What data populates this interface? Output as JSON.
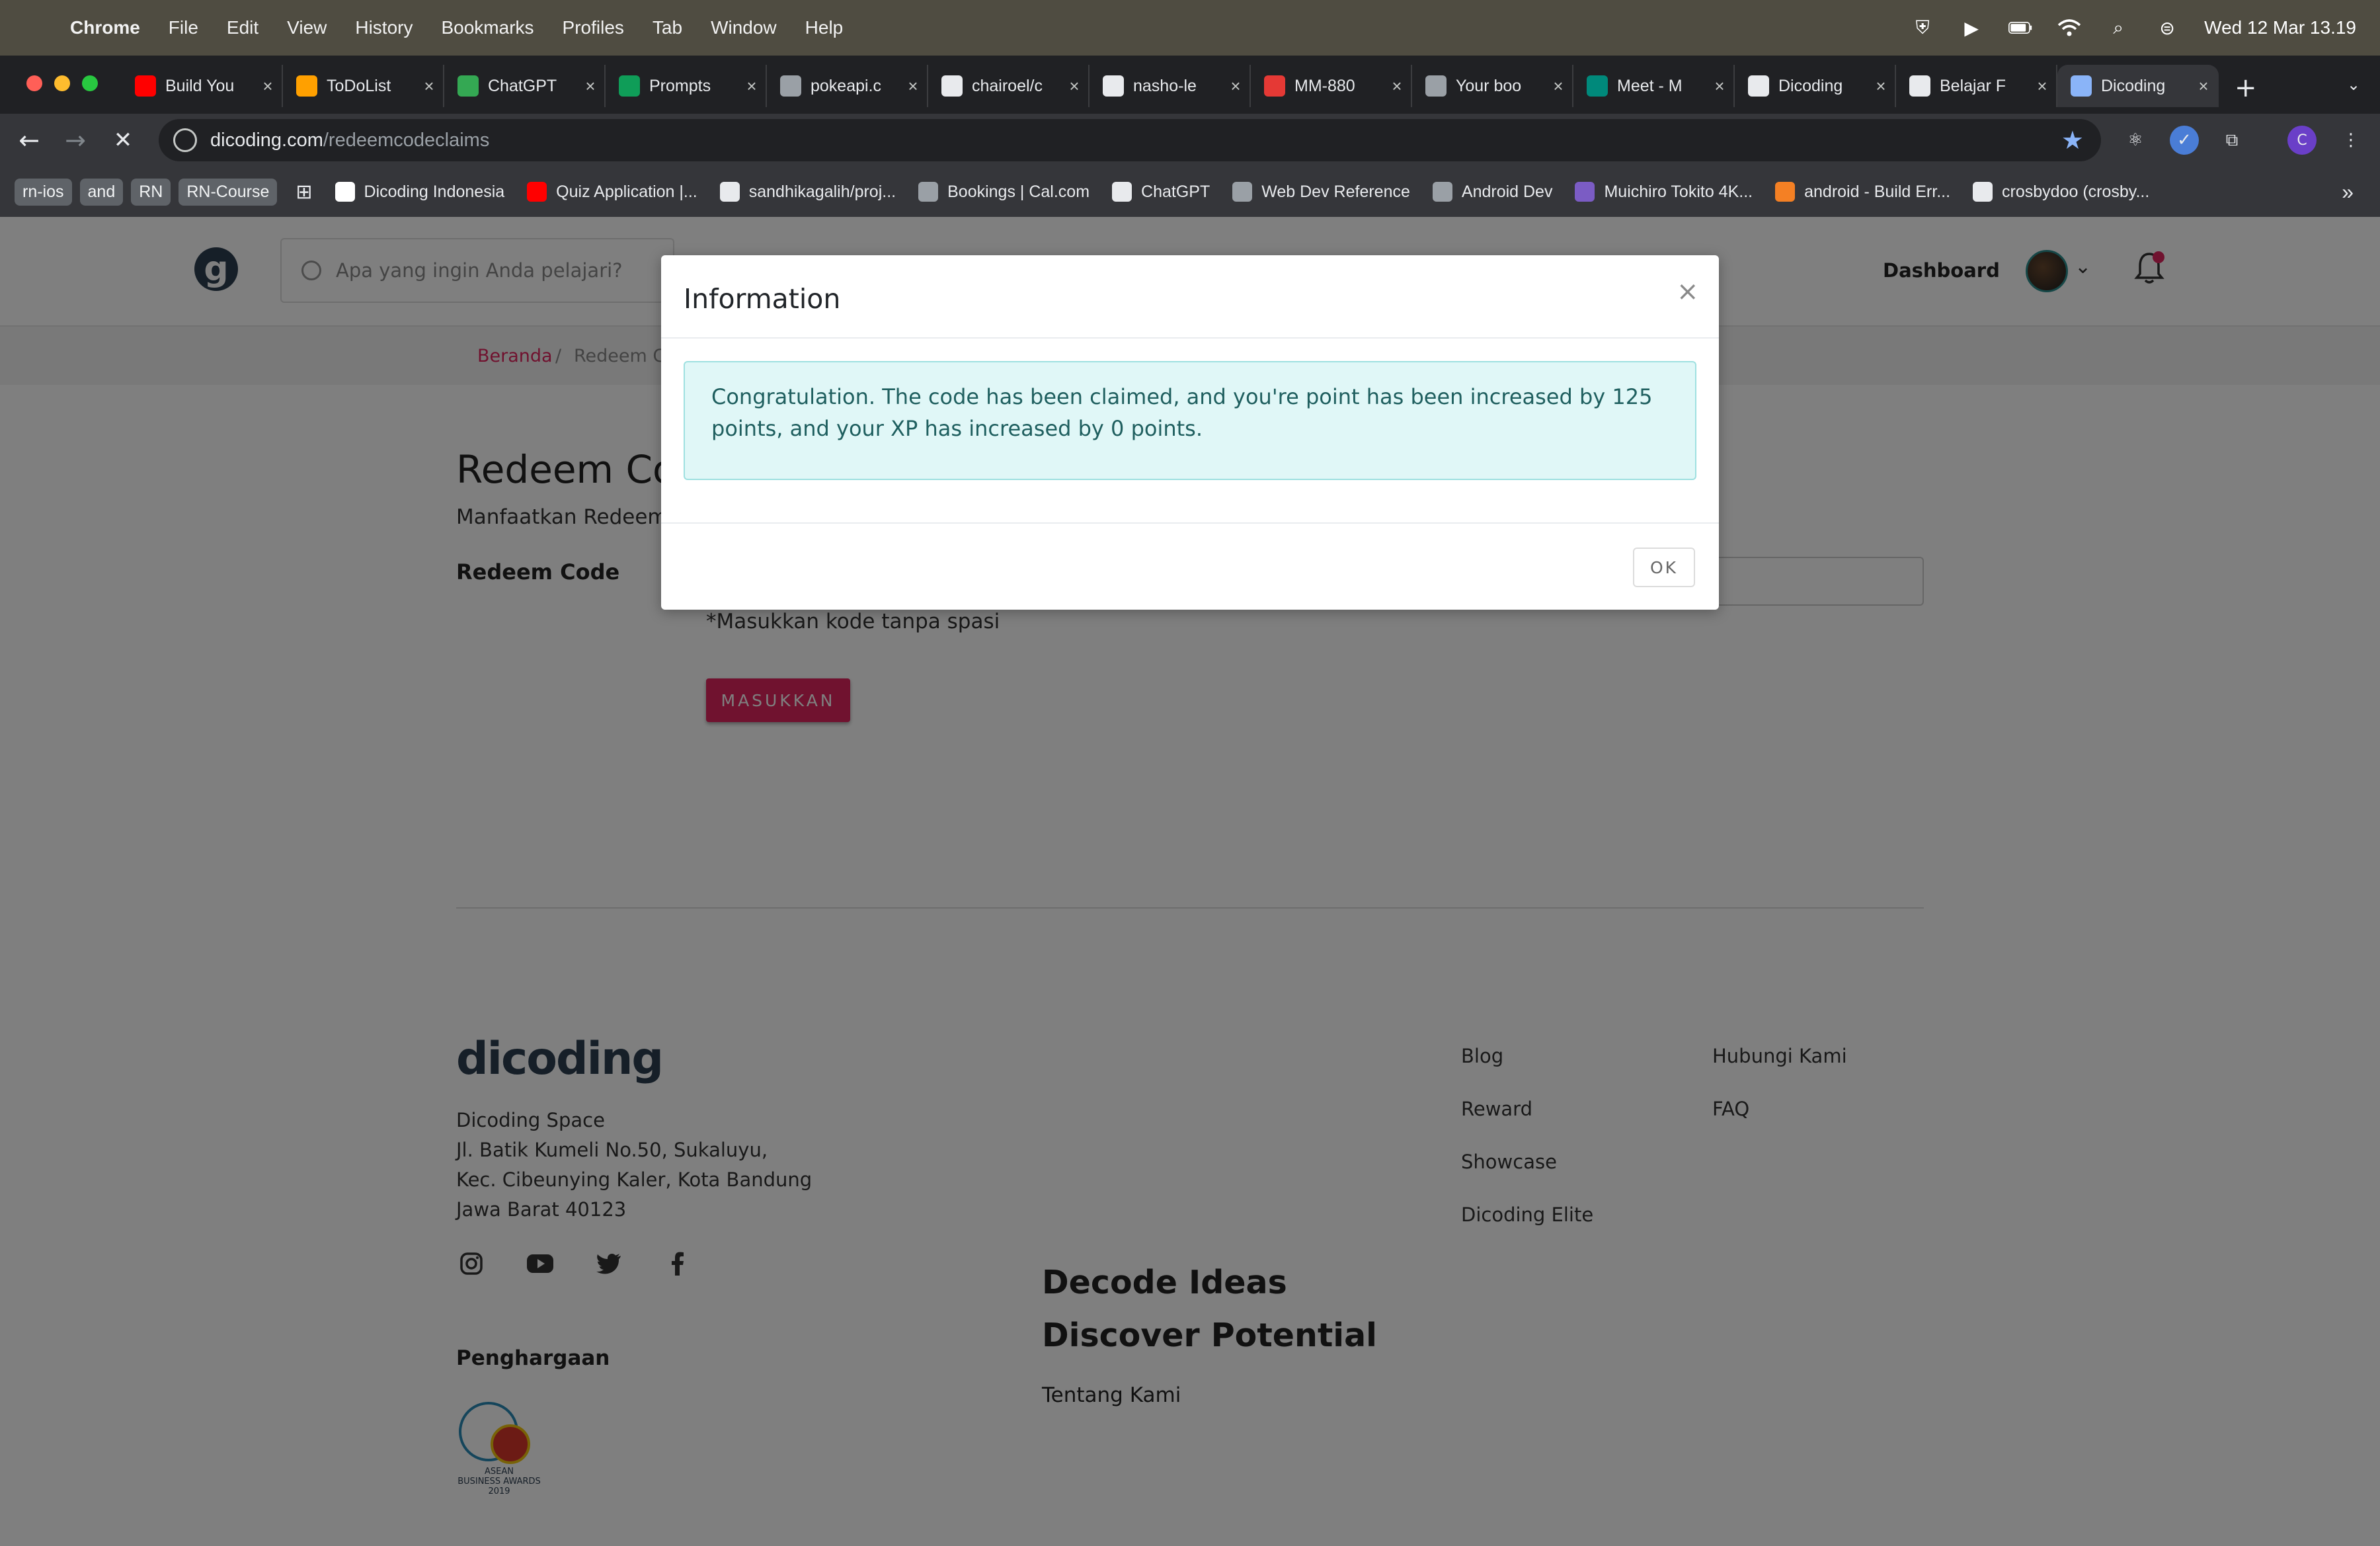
{
  "menubar": {
    "app": "Chrome",
    "items": [
      "File",
      "Edit",
      "View",
      "History",
      "Bookmarks",
      "Profiles",
      "Tab",
      "Window",
      "Help"
    ],
    "clock": "Wed 12 Mar  13.19"
  },
  "tabs": [
    {
      "label": "Build You",
      "icon": "youtube-icon",
      "color": "#ff0000"
    },
    {
      "label": "ToDoList",
      "icon": "firebase-icon",
      "color": "#ffa000"
    },
    {
      "label": "ChatGPT",
      "icon": "google-drive-icon",
      "color": "#34a853"
    },
    {
      "label": "Prompts",
      "icon": "google-sheets-icon",
      "color": "#0f9d58"
    },
    {
      "label": "pokeapi.c",
      "icon": "globe-icon",
      "color": "#9aa0a6"
    },
    {
      "label": "chairoel/c",
      "icon": "github-icon",
      "color": "#e8eaed"
    },
    {
      "label": "nasho-le",
      "icon": "github-icon",
      "color": "#e8eaed"
    },
    {
      "label": "MM-880",
      "icon": "tab-icon",
      "color": "#e53935"
    },
    {
      "label": "Your boo",
      "icon": "cal-icon",
      "color": "#9aa0a6"
    },
    {
      "label": "Meet - M",
      "icon": "meet-icon",
      "color": "#00897b"
    },
    {
      "label": "Dicoding",
      "icon": "dicoding-icon",
      "color": "#e8eaed"
    },
    {
      "label": "Belajar F",
      "icon": "dicoding-icon",
      "color": "#e8eaed"
    },
    {
      "label": "Dicoding",
      "icon": "dicoding-icon",
      "color": "#8ab4f8",
      "active": true
    }
  ],
  "address_bar": {
    "domain": "dicoding.com",
    "path": "/redeemcodeclaims"
  },
  "bookmarks": {
    "chips": [
      "rn-ios",
      "and",
      "RN",
      "RN-Course"
    ],
    "items": [
      {
        "label": "Dicoding Indonesia",
        "icon": "dicoding-icon",
        "color": "#ffffff"
      },
      {
        "label": "Quiz Application |...",
        "icon": "youtube-icon",
        "color": "#ff0000"
      },
      {
        "label": "sandhikagalih/proj...",
        "icon": "github-icon",
        "color": "#e8eaed"
      },
      {
        "label": "Bookings | Cal.com",
        "icon": "cal-icon",
        "color": "#9aa0a6"
      },
      {
        "label": "ChatGPT",
        "icon": "openai-icon",
        "color": "#e8eaed"
      },
      {
        "label": "Web Dev Reference",
        "icon": "folder-icon",
        "color": "#9aa0a6"
      },
      {
        "label": "Android Dev",
        "icon": "folder-icon",
        "color": "#9aa0a6"
      },
      {
        "label": "Muichiro Tokito 4K...",
        "icon": "image-icon",
        "color": "#7b5cc4"
      },
      {
        "label": "android - Build Err...",
        "icon": "stackoverflow-icon",
        "color": "#f48024"
      },
      {
        "label": "crosbydoo (crosby...",
        "icon": "github-icon",
        "color": "#e8eaed"
      }
    ],
    "more": "»"
  },
  "header": {
    "search_placeholder": "Apa yang ingin Anda pelajari?",
    "dashboard": "Dashboard"
  },
  "breadcrumb": {
    "home": "Beranda",
    "sep": "/",
    "current": "Redeem Co"
  },
  "redeem": {
    "title": "Redeem Code",
    "subtitle": "Manfaatkan Redeem",
    "label": "Redeem Code",
    "hint": "*Masukkan kode tanpa spasi",
    "button": "MASUKKAN"
  },
  "footer": {
    "logo": "dicoding",
    "address": [
      "Dicoding Space",
      "Jl. Batik Kumeli No.50, Sukaluyu,",
      "Kec. Cibeunying Kaler, Kota Bandung",
      "Jawa Barat 40123"
    ],
    "award_title": "Penghargaan",
    "award_text": [
      "ASEAN",
      "BUSINESS AWARDS",
      "2019"
    ],
    "tagline1": "Decode Ideas",
    "tagline2": "Discover Potential",
    "about": "Tentang Kami",
    "links_col1": [
      "Blog",
      "Reward",
      "Showcase",
      "Dicoding Elite"
    ],
    "links_col2": [
      "Hubungi Kami",
      "FAQ"
    ]
  },
  "modal": {
    "title": "Information",
    "close": "×",
    "message": "Congratulation. The code has been claimed, and you're point has been increased by 125 points, and your XP has increased by 0 points.",
    "ok": "OK"
  }
}
